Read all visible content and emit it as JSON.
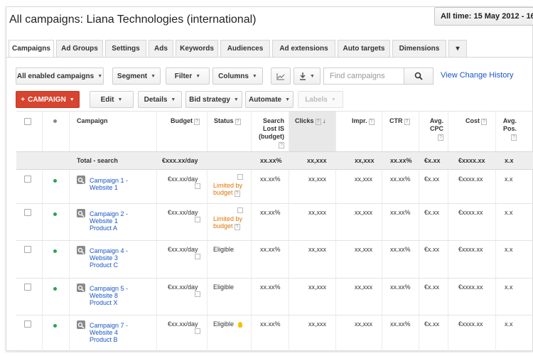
{
  "header": {
    "title": "All campaigns: Liana Technologies (international)",
    "date_range": "All time: 15 May 2012 - 16"
  },
  "tabs": [
    {
      "label": "Campaigns",
      "active": true
    },
    {
      "label": "Ad Groups"
    },
    {
      "label": "Settings"
    },
    {
      "label": "Ads"
    },
    {
      "label": "Keywords"
    },
    {
      "label": "Audiences"
    },
    {
      "label": "Ad extensions"
    },
    {
      "label": "Auto targets"
    },
    {
      "label": "Dimensions"
    },
    {
      "label": "▾"
    }
  ],
  "toolbar": {
    "filter_campaigns": "All enabled campaigns",
    "segment": "Segment",
    "filter": "Filter",
    "columns": "Columns",
    "search_placeholder": "Find campaigns",
    "view_history": "View Change History",
    "campaign": "CAMPAIGN",
    "edit": "Edit",
    "details": "Details",
    "bid_strategy": "Bid strategy",
    "automate": "Automate",
    "labels": "Labels"
  },
  "columns": {
    "campaign": "Campaign",
    "budget": "Budget",
    "status": "Status",
    "search_lost_1": "Search",
    "search_lost_2": "Lost IS",
    "search_lost_3": "(budget)",
    "clicks": "Clicks",
    "impr": "Impr.",
    "ctr": "CTR",
    "avg_cpc_1": "Avg.",
    "avg_cpc_2": "CPC",
    "cost": "Cost",
    "avg_pos_1": "Avg.",
    "avg_pos_2": "Pos.",
    "help": "?"
  },
  "total": {
    "label": "Total - search",
    "budget": "€xxx.xx/day",
    "lost_is": "xx.xx%",
    "clicks": "xx,xxx",
    "impr": "xx,xxx",
    "ctr": "xx.xx%",
    "cpc": "€x.xx",
    "cost": "€xxxx.xx",
    "pos": "x.x"
  },
  "rows": [
    {
      "line1": "Campaign 1 -",
      "line2": "Website 1",
      "line3": "",
      "budget": "€xx.xx/day",
      "status1": "Limited by",
      "status2": "budget",
      "limited": true,
      "lost_is": "xx.xx%",
      "clicks": "xx,xxx",
      "impr": "xx,xxx",
      "ctr": "xx.xx%",
      "cpc": "€x.xx",
      "cost": "€xxxx.xx",
      "pos": "x.x"
    },
    {
      "line1": "Campaign 2 -",
      "line2": "Website 1",
      "line3": "Product A",
      "budget": "€xx.xx/day",
      "status1": "Limited by",
      "status2": "budget",
      "limited": true,
      "lost_is": "xx.xx%",
      "clicks": "xx,xxx",
      "impr": "xx,xxx",
      "ctr": "xx.xx%",
      "cpc": "€x.xx",
      "cost": "€xxxx.xx",
      "pos": "x.x"
    },
    {
      "line1": "Campaign 4 -",
      "line2": "Website 3",
      "line3": "Product C",
      "budget": "€xx.xx/day",
      "status1": "Eligible",
      "status2": "",
      "limited": false,
      "lost_is": "xx.xx%",
      "clicks": "xx,xxx",
      "impr": "xx,xxx",
      "ctr": "xx.xx%",
      "cpc": "€x.xx",
      "cost": "€xxxx.xx",
      "pos": "x.x"
    },
    {
      "line1": "Campaign 5 -",
      "line2": "Website 8",
      "line3": "Product X",
      "budget": "€xx.xx/day",
      "status1": "Eligible",
      "status2": "",
      "limited": false,
      "lost_is": "xx.xx%",
      "clicks": "xx,xxx",
      "impr": "xx,xxx",
      "ctr": "xx.xx%",
      "cpc": "€x.xx",
      "cost": "€xxxx.xx",
      "pos": "x.x"
    },
    {
      "line1": "Campaign 7 -",
      "line2": "Website 4",
      "line3": "Product B",
      "budget": "€xx.xx/day",
      "status1": "Eligible",
      "status2": "",
      "limited": false,
      "lost_is": "xx.xx%",
      "clicks": "xx,xxx",
      "impr": "xx,xxx",
      "ctr": "xx.xx%",
      "cpc": "€x.xx",
      "cost": "€xxxx.xx",
      "pos": "x.x"
    }
  ],
  "colors": {
    "accent": "#d7442f",
    "link": "#1a55c8",
    "warning": "#e07400",
    "enabled": "#2aa44e"
  }
}
